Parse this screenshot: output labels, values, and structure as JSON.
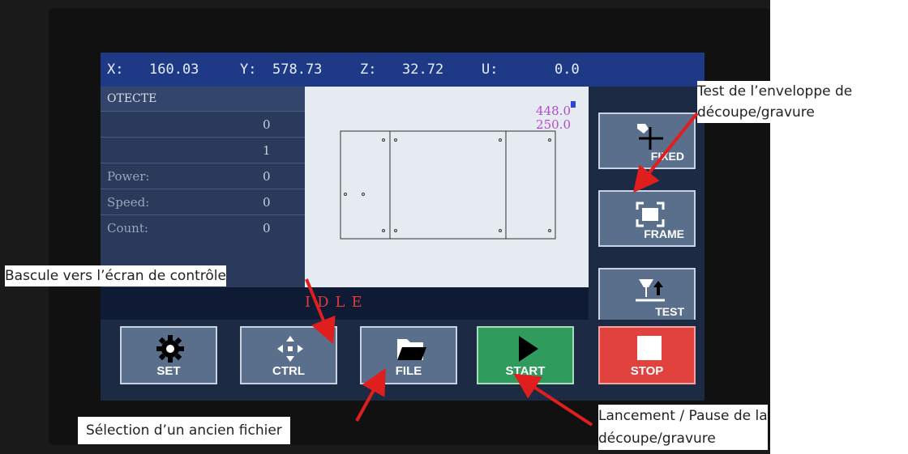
{
  "coords": {
    "x_label": "X:",
    "x_value": "160.03",
    "y_label": "Y:",
    "y_value": "578.73",
    "z_label": "Z:",
    "z_value": "32.72",
    "u_label": "U:",
    "u_value": "0.0"
  },
  "info": {
    "title": "OTECTE",
    "rows": [
      {
        "label": "",
        "value": "0"
      },
      {
        "label": "",
        "value": "1"
      },
      {
        "label": "Power:",
        "value": "0"
      },
      {
        "label": "Speed:",
        "value": "0"
      },
      {
        "label": "Count:",
        "value": "0"
      }
    ]
  },
  "preview": {
    "width_value": "448.0",
    "height_value": "250.0"
  },
  "status": {
    "text": "IDLE"
  },
  "side_buttons": {
    "fixed": "FIXED",
    "frame": "FRAME",
    "test": "TEST"
  },
  "bottom_buttons": {
    "set": "SET",
    "ctrl": "CTRL",
    "file": "FILE",
    "start": "START",
    "stop": "STOP"
  },
  "annotations": {
    "frame_note_line1": "Test de l’enveloppe de",
    "frame_note_line2": "découpe/gravure",
    "ctrl_note": "Bascule vers l’écran de contrôle",
    "file_note": "Sélection d’un ancien fichier",
    "start_note_line1": "Lancement / Pause de la",
    "start_note_line2": "découpe/gravure"
  },
  "colors": {
    "coord_bar": "#1e3a86",
    "start_button": "#2f9c5e",
    "stop_button": "#e2423d",
    "status_text": "#e03a3a",
    "annotation_arrow": "#e01e1e"
  },
  "icons": {
    "set": "gear-icon",
    "ctrl": "move-arrows-icon",
    "file": "folder-icon",
    "start": "play-icon",
    "stop": "stop-square-icon",
    "fixed": "fixed-origin-icon",
    "frame": "frame-icon",
    "test": "laser-test-icon"
  }
}
